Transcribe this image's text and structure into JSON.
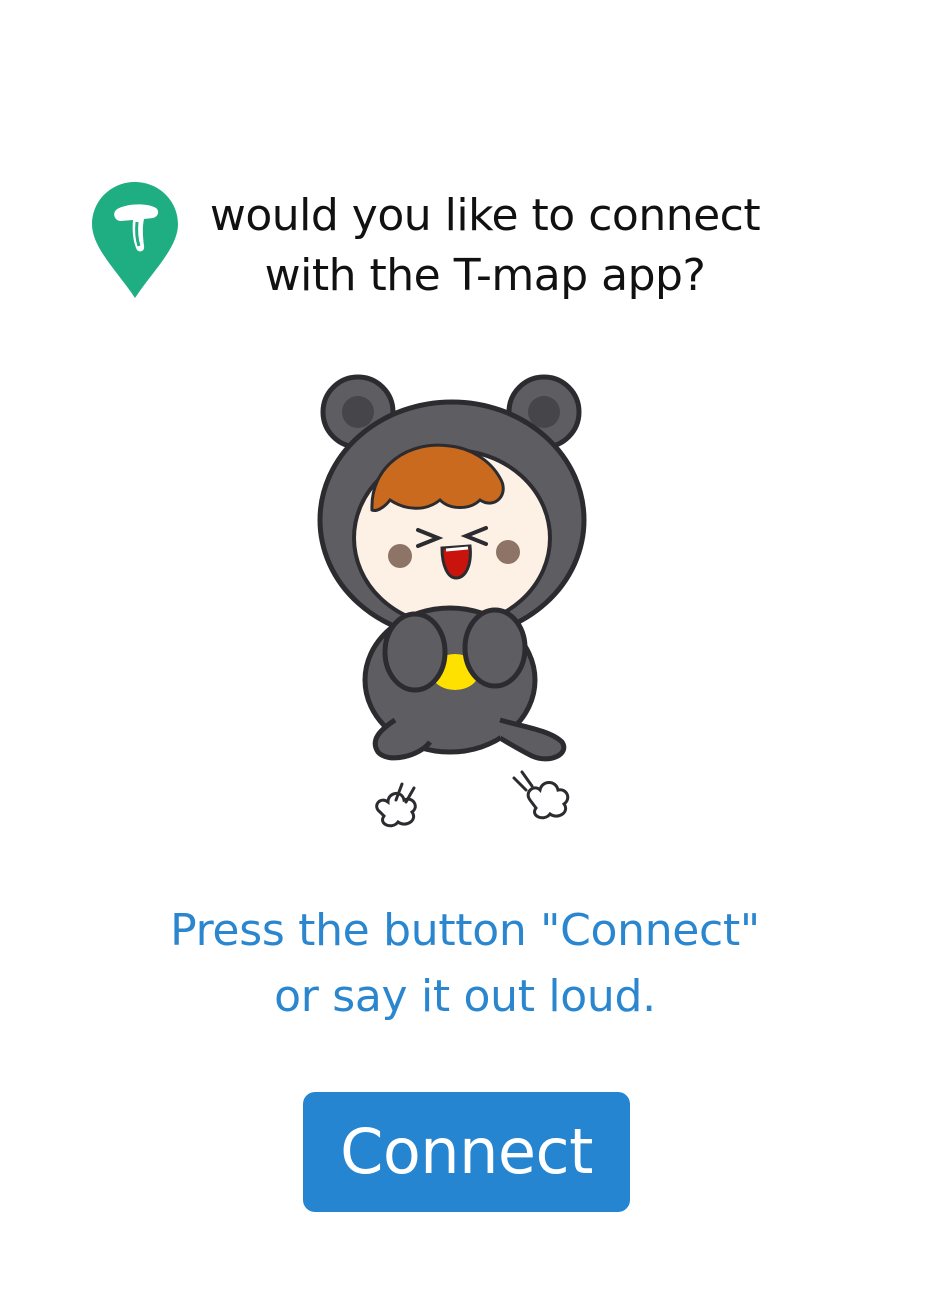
{
  "dialog": {
    "question_line1": "would you like to connect",
    "question_line2": "with the T-map app?",
    "instruction_line1": "Press the button \"Connect\"",
    "instruction_line2": "or say it out loud.",
    "connect_label": "Connect"
  },
  "icons": {
    "app_icon": "tmap-pin-icon",
    "illustration": "bear-costume-mascot"
  },
  "colors": {
    "brand_green": "#1fae82",
    "accent_blue": "#2585d1",
    "instruction_text": "#2a86cf"
  }
}
